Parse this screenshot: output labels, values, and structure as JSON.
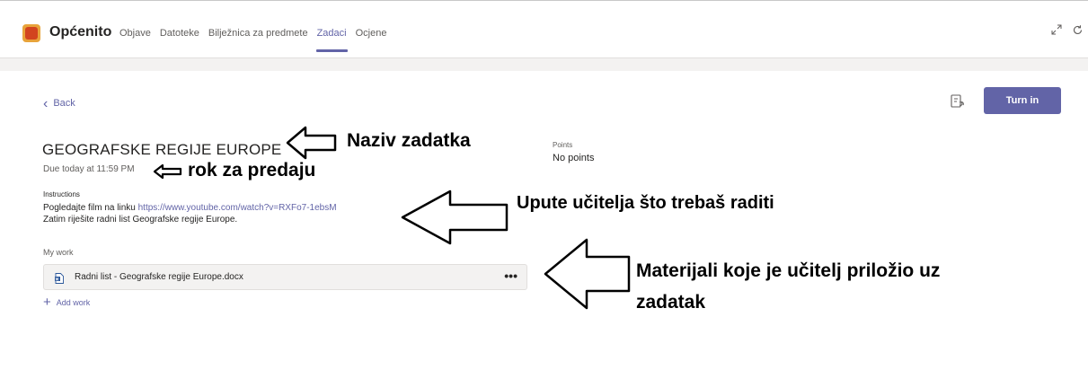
{
  "header": {
    "channel": "Općenito",
    "tabs": [
      {
        "label": "Objave",
        "active": false
      },
      {
        "label": "Datoteke",
        "active": false
      },
      {
        "label": "Bilježnica za predmete",
        "active": false
      },
      {
        "label": "Zadaci",
        "active": true
      },
      {
        "label": "Ocjene",
        "active": false
      }
    ],
    "expand_icon": "expand-icon",
    "refresh_icon": "refresh-icon"
  },
  "assignment": {
    "back_label": "Back",
    "turn_in_label": "Turn in",
    "title": "GEOGRAFSKE REGIJE EUROPE",
    "due": "Due today at 11:59 PM",
    "points_label": "Points",
    "points_value": "No points",
    "instructions_label": "Instructions",
    "instructions_line1_text": "Pogledajte film na linku ",
    "instructions_link": "https://www.youtube.com/watch?v=RXFo7-1ebsM",
    "instructions_line2": "Zatim riješite radni list Geografske regije Europe.",
    "my_work_label": "My work",
    "file_name": "Radni list - Geografske regije Europe.docx",
    "file_more": "•••",
    "add_work_label": "Add work"
  },
  "annotations": {
    "title_note": "Naziv zadatka",
    "due_note": "rok za predaju",
    "instructions_note": "Upute učitelja što trebaš raditi",
    "materials_note_line1": "Materijali koje je učitelj priložio uz",
    "materials_note_line2": "zadatak"
  },
  "colors": {
    "accent": "#6264a7",
    "team_icon": "#d2441f",
    "background_band": "#f3f2f1"
  }
}
